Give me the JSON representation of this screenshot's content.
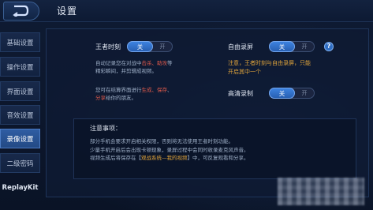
{
  "header": {
    "title": "设置"
  },
  "sidebar": {
    "items": [
      {
        "label": "基础设置"
      },
      {
        "label": "操作设置"
      },
      {
        "label": "界面设置"
      },
      {
        "label": "音效设置"
      },
      {
        "label": "录像设置",
        "active": true
      },
      {
        "label": "二级密码"
      },
      {
        "label": "ReplayKit"
      }
    ]
  },
  "king_moment": {
    "label": "王者时刻",
    "on_label": "关",
    "off_label": "开",
    "state": "关",
    "desc_1": "自动记录您在对战中",
    "desc_hl": "击杀、助攻",
    "desc_2": "等",
    "desc_3": "精彩瞬间，并剪辑成视频。",
    "desc_4": "您可在结算界面进行",
    "desc_hl2": "生成、保存",
    "desc_5": "、",
    "desc_hl3": "分享",
    "desc_6": "给你的朋友。"
  },
  "auto_record": {
    "label": "自由录屏",
    "on_label": "关",
    "off_label": "开",
    "state": "关",
    "warning_1": "注意，王者时刻与自由录屏，只能",
    "warning_2": "开启其中一个"
  },
  "hd_record": {
    "label": "高清录制",
    "on_label": "关",
    "off_label": "开",
    "state": "关"
  },
  "notes": {
    "title": "注意事项：",
    "line_1": "部分手机会要求开启相关权限，否则将无法使用王者时刻功能。",
    "line_2": "少量手机开启后会出现卡顿现象，录屏过程中会同时收录麦克风声音。",
    "line_3a": "视频生成后将保存在【",
    "line_3hl": "观战系统—我的视频",
    "line_3b": "】中，可反复观看和分享。"
  },
  "colors": {
    "accent": "#3d82df",
    "highlight": "#e0a43b",
    "warning": "#e0a43b"
  }
}
